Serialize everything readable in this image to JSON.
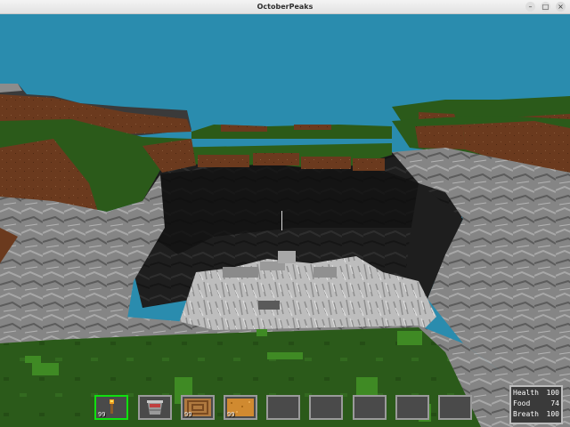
{
  "window": {
    "title": "OctoberPeaks",
    "minimize_glyph": "–",
    "maximize_glyph": "□",
    "close_glyph": "×"
  },
  "colors": {
    "sky": "#2a8cae",
    "grass": "#2d5a1c",
    "grass_light": "#3f8a24",
    "dirt": "#6e3b1f",
    "stone_dark": "#1c1c1c",
    "stone": "#8a8a8a",
    "stone_light": "#c4c4c4",
    "selected_slot": "#10e010"
  },
  "hotbar": {
    "selected_index": 0,
    "slots": [
      {
        "item": "torch-icon",
        "count": "99"
      },
      {
        "item": "bucket-icon",
        "count": ""
      },
      {
        "item": "wood-planks-icon",
        "count": "99"
      },
      {
        "item": "sand-block-icon",
        "count": "99"
      },
      {
        "item": "",
        "count": ""
      },
      {
        "item": "",
        "count": ""
      },
      {
        "item": "",
        "count": ""
      },
      {
        "item": "",
        "count": ""
      },
      {
        "item": "",
        "count": ""
      }
    ]
  },
  "stats": {
    "health_label": "Health",
    "health_value": "100",
    "food_label": "Food",
    "food_value": "74",
    "breath_label": "Breath",
    "breath_value": "100"
  }
}
